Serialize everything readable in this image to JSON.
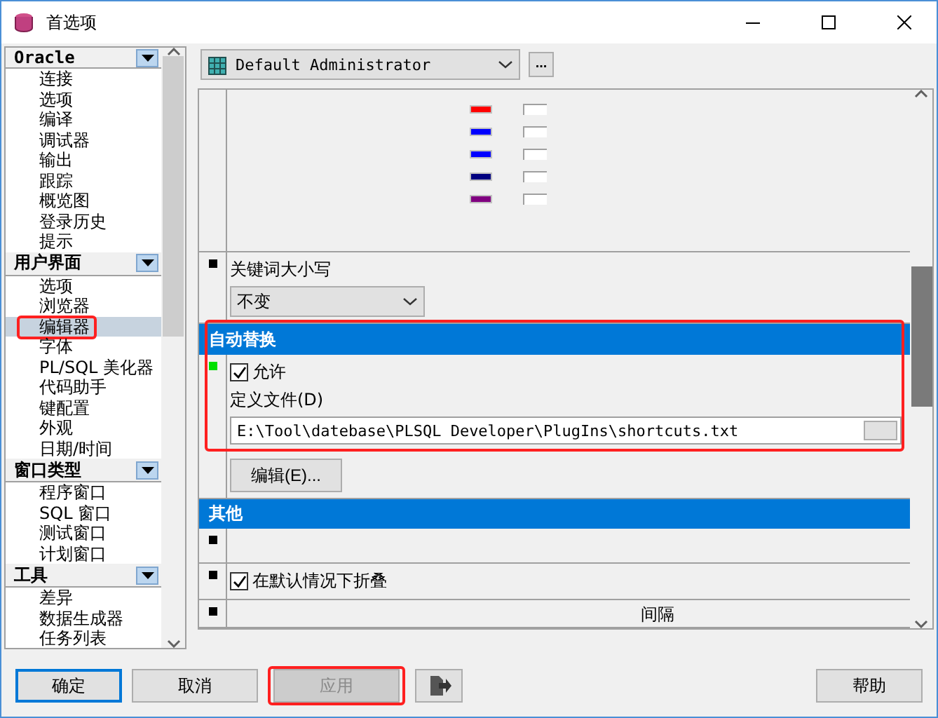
{
  "window": {
    "title": "首选项"
  },
  "sidebar": {
    "groups": [
      {
        "title": "Oracle",
        "items": [
          {
            "label": "连接",
            "selected": false
          },
          {
            "label": "选项",
            "selected": false
          },
          {
            "label": "编译",
            "selected": false
          },
          {
            "label": "调试器",
            "selected": false
          },
          {
            "label": "输出",
            "selected": false
          },
          {
            "label": "跟踪",
            "selected": false
          },
          {
            "label": "概览图",
            "selected": false
          },
          {
            "label": "登录历史",
            "selected": false
          },
          {
            "label": "提示",
            "selected": false
          }
        ]
      },
      {
        "title": "用户界面",
        "items": [
          {
            "label": "选项",
            "selected": false
          },
          {
            "label": "浏览器",
            "selected": false
          },
          {
            "label": "编辑器",
            "selected": true
          },
          {
            "label": "字体",
            "selected": false
          },
          {
            "label": "PL/SQL 美化器",
            "selected": false
          },
          {
            "label": "代码助手",
            "selected": false
          },
          {
            "label": "键配置",
            "selected": false
          },
          {
            "label": "外观",
            "selected": false
          },
          {
            "label": "日期/时间",
            "selected": false
          }
        ]
      },
      {
        "title": "窗口类型",
        "items": [
          {
            "label": "程序窗口",
            "selected": false
          },
          {
            "label": "SQL 窗口",
            "selected": false
          },
          {
            "label": "测试窗口",
            "selected": false
          },
          {
            "label": "计划窗口",
            "selected": false
          }
        ]
      },
      {
        "title": "工具",
        "items": [
          {
            "label": "差异",
            "selected": false
          },
          {
            "label": "数据生成器",
            "selected": false
          },
          {
            "label": "任务列表",
            "selected": false
          }
        ]
      }
    ]
  },
  "profile": {
    "value": "Default Administrator",
    "more_button": "..."
  },
  "color_rows": [
    {
      "color": "#ff0000"
    },
    {
      "color": "#0000ff"
    },
    {
      "color": "#0000ff"
    },
    {
      "color": "#000080"
    },
    {
      "color": "#800080"
    }
  ],
  "keyword_case": {
    "label": "关键词大小写",
    "value": "不变"
  },
  "auto_replace": {
    "title": "自动替换",
    "allow": {
      "label": "允许",
      "checked": true
    },
    "file_label": "定义文件(D)",
    "file_value": "E:\\Tool\\datebase\\PLSQL Developer\\PlugIns\\shortcuts.txt",
    "edit_button": "编辑(E)..."
  },
  "other": {
    "title": "其他",
    "collapse": {
      "label": "在默认情况下折叠",
      "checked": true
    },
    "interval_label": "间隔"
  },
  "buttons": {
    "ok": "确定",
    "cancel": "取消",
    "apply": {
      "label": "应用",
      "disabled": true
    },
    "help": "帮助"
  }
}
